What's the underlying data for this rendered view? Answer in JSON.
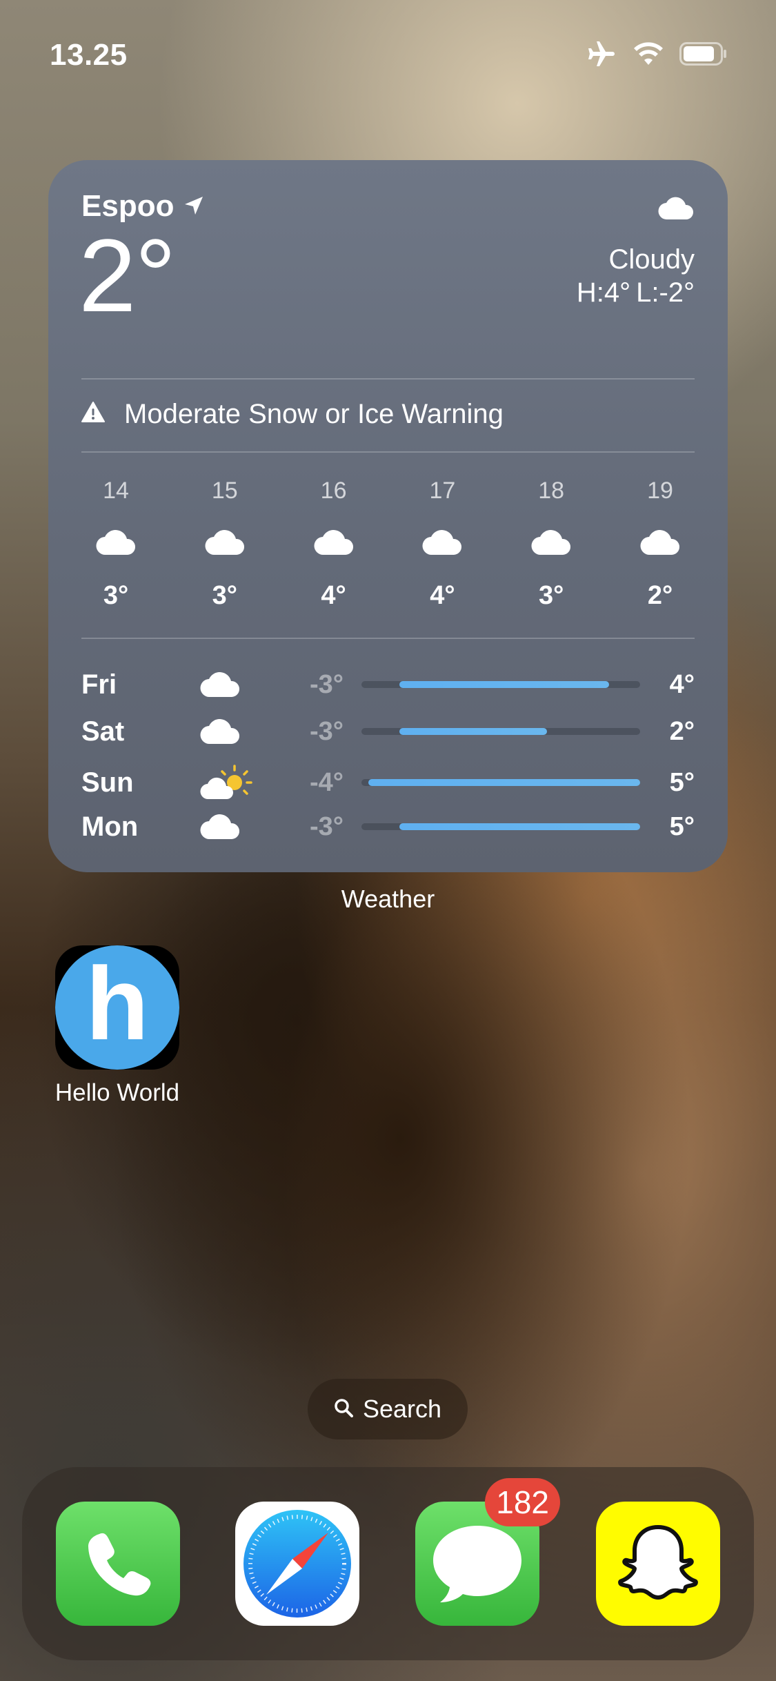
{
  "status_bar": {
    "time": "13.25",
    "icons": [
      "airplane-icon",
      "wifi-icon",
      "battery-icon"
    ]
  },
  "weather_widget": {
    "location": "Espoo",
    "current_temp": "2°",
    "condition": "Cloudy",
    "high": "H:4°",
    "low": "L:-2°",
    "warning": "Moderate Snow or Ice Warning",
    "hourly": [
      {
        "hour": "14",
        "icon": "cloud-icon",
        "temp": "3°"
      },
      {
        "hour": "15",
        "icon": "cloud-icon",
        "temp": "3°"
      },
      {
        "hour": "16",
        "icon": "cloud-icon",
        "temp": "4°"
      },
      {
        "hour": "17",
        "icon": "cloud-icon",
        "temp": "4°"
      },
      {
        "hour": "18",
        "icon": "cloud-icon",
        "temp": "3°"
      },
      {
        "hour": "19",
        "icon": "cloud-icon",
        "temp": "2°"
      }
    ],
    "daily": [
      {
        "day": "Fri",
        "icon": "cloud-icon",
        "low": "-3°",
        "high": "4°",
        "low_value": -3,
        "high_value": 4
      },
      {
        "day": "Sat",
        "icon": "cloud-icon",
        "low": "-3°",
        "high": "2°",
        "low_value": -3,
        "high_value": 2
      },
      {
        "day": "Sun",
        "icon": "partly-sunny-icon",
        "low": "-4°",
        "high": "5°",
        "low_value": -4,
        "high_value": 5
      },
      {
        "day": "Mon",
        "icon": "cloud-icon",
        "low": "-3°",
        "high": "5°",
        "low_value": -3,
        "high_value": 5
      }
    ],
    "range_min": -4,
    "range_max": 5
  },
  "widget_caption": "Weather",
  "home_apps": [
    {
      "label": "Hello World",
      "glyph": "h"
    }
  ],
  "search_label": "Search",
  "dock": [
    {
      "name": "Phone",
      "icon": "phone-icon"
    },
    {
      "name": "Safari",
      "icon": "compass-icon"
    },
    {
      "name": "Messages",
      "icon": "message-bubble-icon",
      "badge": "182"
    },
    {
      "name": "Snapchat",
      "icon": "ghost-icon"
    }
  ],
  "colors": {
    "widget_bg": "#6a7180",
    "temp_bar": "#5fb0f0",
    "badge": "#e5463a",
    "hello_world_blue": "#4aa8ea"
  }
}
